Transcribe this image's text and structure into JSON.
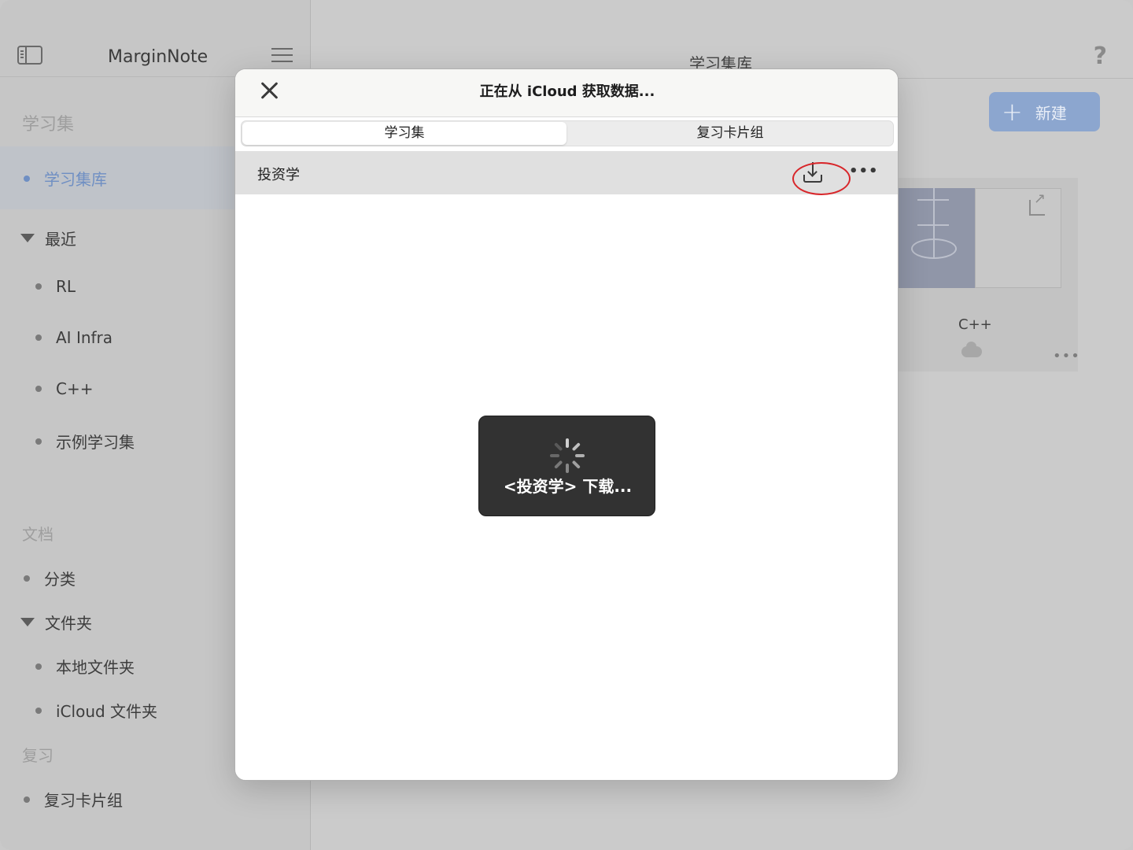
{
  "sidebar": {
    "app_title": "MarginNote",
    "sections": {
      "study": "学习集",
      "docs": "文档",
      "review": "复习"
    },
    "items": {
      "library": "学习集库",
      "recent": "最近",
      "recent_rl": "RL",
      "recent_ai": "AI Infra",
      "recent_cpp": "C++",
      "recent_sample": "示例学习集",
      "categories": "分类",
      "folders": "文件夹",
      "local_folder": "本地文件夹",
      "icloud_folder": "iCloud 文件夹",
      "review_cards": "复习卡片组"
    }
  },
  "main": {
    "title": "学习集库",
    "help": "?",
    "new_button": "新建",
    "card_title": "C++",
    "card_more": "•••"
  },
  "modal": {
    "title": "正在从 iCloud 获取数据...",
    "tabs": [
      "学习集",
      "复习卡片组"
    ],
    "row_title": "投资学",
    "row_more": "•••",
    "toast": "<投资学> 下载..."
  },
  "colors": {
    "accent": "#6f8fc3",
    "highlight": "#d8262a",
    "toast_bg": "#323232"
  }
}
